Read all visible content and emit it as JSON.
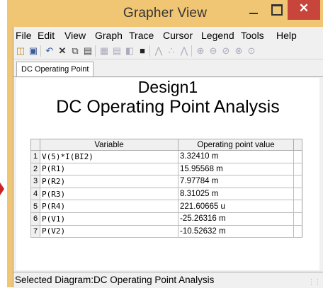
{
  "window": {
    "title": "Grapher View",
    "close_glyph": "✕"
  },
  "menu": [
    "File",
    "Edit",
    "View",
    "Graph",
    "Trace",
    "Cursor",
    "Legend",
    "Tools",
    "Help"
  ],
  "toolbar_icons": [
    "open-icon",
    "save-icon",
    "undo-icon",
    "delete-icon",
    "copy-icon",
    "paste-icon",
    "grid-icon",
    "table-icon",
    "stack-plot-icon",
    "copy-window-icon",
    "line-plot-icon",
    "scatter-plot-icon",
    "line-marker-plot-icon",
    "zoom-in-icon",
    "zoom-out-icon",
    "zoom-area-icon",
    "zoom-fit-icon",
    "zoom-x-icon"
  ],
  "tabs": [
    "DC Operating Point"
  ],
  "diagram": {
    "design": "Design1",
    "analysis": "DC Operating Point Analysis"
  },
  "table": {
    "headers": [
      "Variable",
      "Operating point value"
    ],
    "rows": [
      {
        "n": "1",
        "variable": "V(5)*I(BI2)",
        "value": "3.32410 m"
      },
      {
        "n": "2",
        "variable": "P(R1)",
        "value": "15.95568 m"
      },
      {
        "n": "3",
        "variable": "P(R2)",
        "value": "7.97784 m"
      },
      {
        "n": "4",
        "variable": "P(R3)",
        "value": "8.31025 m"
      },
      {
        "n": "5",
        "variable": "P(R4)",
        "value": "221.60665 u"
      },
      {
        "n": "6",
        "variable": "P(V1)",
        "value": "-25.26316 m"
      },
      {
        "n": "7",
        "variable": "P(V2)",
        "value": "-10.52632 m"
      }
    ]
  },
  "status": {
    "text": "Selected Diagram:DC Operating Point Analysis"
  }
}
